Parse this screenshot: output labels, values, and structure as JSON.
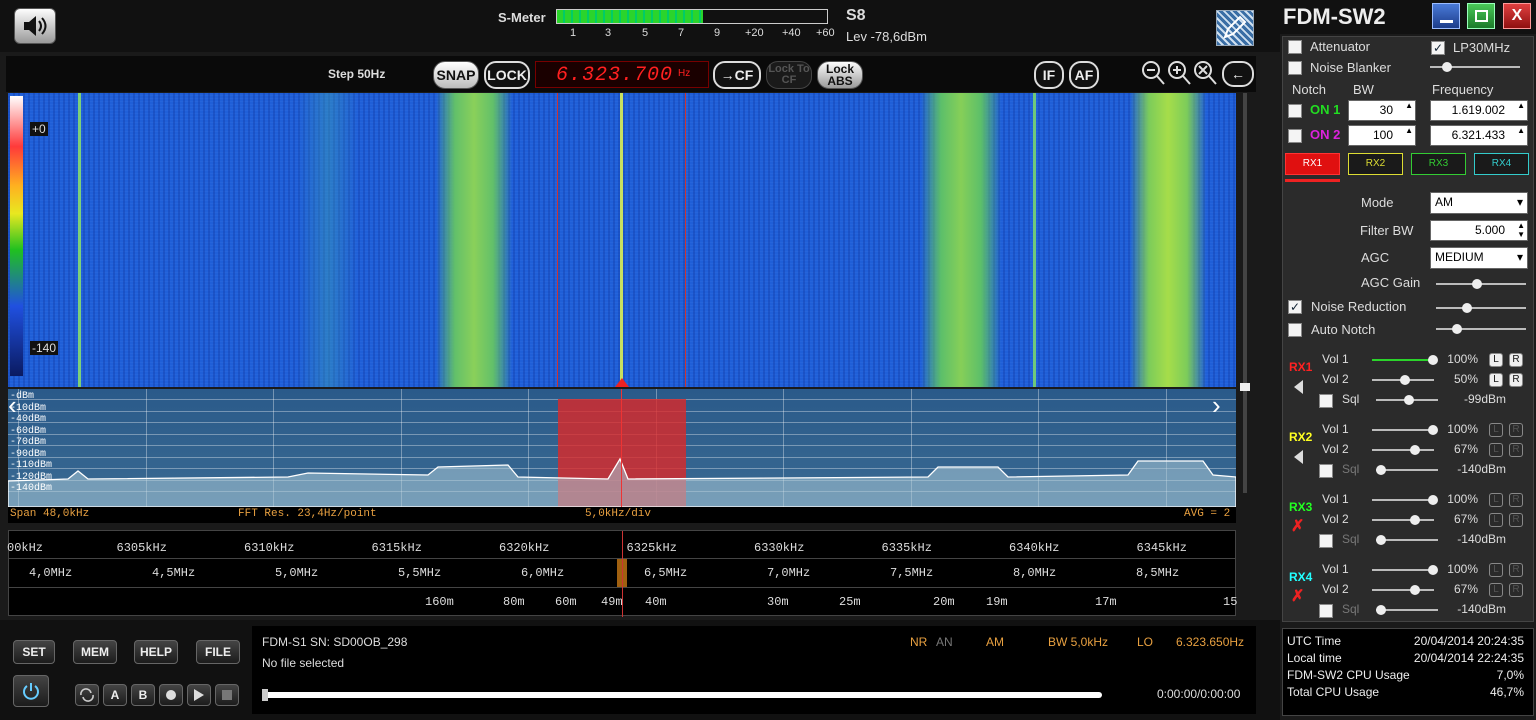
{
  "app": {
    "title": "FDM-SW2",
    "minimize_icon": "minimize-icon",
    "maximize_icon": "maximize-icon",
    "close_label": "X"
  },
  "top": {
    "smeter_label": "S-Meter",
    "smeter_scale": [
      "1",
      "3",
      "5",
      "7",
      "9",
      "+20",
      "+40",
      "+60"
    ],
    "smeter_reading": "S8",
    "level": "Lev -78,6dBm",
    "smeter_fill": 0.54
  },
  "toolbar": {
    "step": "Step 50Hz",
    "snap": "SNAP",
    "lock": "LOCK",
    "frequency": "6.323.700",
    "freq_unit": "Hz",
    "to_cf": "→CF",
    "lock_to_cf": "Lock To CF",
    "lock_abs": "Lock ABS",
    "if": "IF",
    "af": "AF",
    "back": "←"
  },
  "waterfall": {
    "scale_top": "+0",
    "scale_bottom": "-140"
  },
  "spectrum": {
    "db_labels": [
      "-dBm",
      "-10dBm",
      "-40dBm",
      "-60dBm",
      "-70dBm",
      "-90dBm",
      "-110dBm",
      "-120dBm",
      "-140dBm"
    ],
    "span": "Span 48,0kHz",
    "fft": "FFT Res. 23,4Hz/point",
    "div": "5,0kHz/div",
    "avg": "AVG = 2"
  },
  "scale": {
    "khz": [
      "00kHz",
      "6305kHz",
      "6310kHz",
      "6315kHz",
      "6320kHz",
      "6325kHz",
      "6330kHz",
      "6335kHz",
      "6340kHz",
      "6345kHz"
    ],
    "mhz": [
      "4,0MHz",
      "4,5MHz",
      "5,0MHz",
      "5,5MHz",
      "6,0MHz",
      "6,5MHz",
      "7,0MHz",
      "7,5MHz",
      "8,0MHz",
      "8,5MHz"
    ],
    "bands": [
      "160m",
      "80m",
      "60m",
      "49m",
      "40m",
      "30m",
      "25m",
      "20m",
      "19m",
      "17m",
      "15"
    ]
  },
  "bottom": {
    "set": "SET",
    "mem": "MEM",
    "help": "HELP",
    "file": "FILE",
    "device": "FDM-S1 SN: SD00OB_298",
    "file_status": "No file selected",
    "nr": "NR",
    "an": "AN",
    "mode": "AM",
    "bw": "BW 5,0kHz",
    "lo": "LO",
    "lo_freq": "6.323.650Hz",
    "time": "0:00:00/0:00:00",
    "transport": {
      "a": "A",
      "b": "B"
    }
  },
  "panel": {
    "attenuator": "Attenuator",
    "lp30": "LP30MHz",
    "noise_blanker": "Noise Blanker",
    "notch_header": "Notch",
    "bw_header": "BW",
    "freq_header": "Frequency",
    "notches": [
      {
        "label": "ON 1",
        "color": "#22dd22",
        "bw": "30",
        "freq": "1.619.002"
      },
      {
        "label": "ON 2",
        "color": "#dd22dd",
        "bw": "100",
        "freq": "6.321.433"
      }
    ],
    "rx_tabs": [
      {
        "label": "RX1",
        "color": "#ff3333"
      },
      {
        "label": "RX2",
        "color": "#dddd33"
      },
      {
        "label": "RX3",
        "color": "#33cc33"
      },
      {
        "label": "RX4",
        "color": "#33cccc"
      }
    ],
    "mode_label": "Mode",
    "mode_value": "AM",
    "filter_label": "Filter BW",
    "filter_value": "5.000",
    "agc_label": "AGC",
    "agc_value": "MEDIUM",
    "agc_gain": "AGC Gain",
    "noise_reduction": "Noise Reduction",
    "auto_notch": "Auto Notch",
    "receivers": [
      {
        "name": "RX1",
        "color": "#ff2222",
        "vol1": "Vol 1",
        "vol1_val": "100%",
        "vol1_level": 1.0,
        "vol2": "Vol 2",
        "vol2_val": "50%",
        "vol2_level": 0.5,
        "sql": "Sql",
        "sql_val": "-99dBm",
        "sql_level": 0.5,
        "active": true
      },
      {
        "name": "RX2",
        "color": "#ffff22",
        "vol1": "Vol 1",
        "vol1_val": "100%",
        "vol1_level": 1.0,
        "vol2": "Vol 2",
        "vol2_val": "67%",
        "vol2_level": 0.67,
        "sql": "Sql",
        "sql_val": "-140dBm",
        "sql_level": 0.0,
        "active": false
      },
      {
        "name": "RX3",
        "color": "#22ff22",
        "vol1": "Vol 1",
        "vol1_val": "100%",
        "vol1_level": 1.0,
        "vol2": "Vol 2",
        "vol2_val": "67%",
        "vol2_level": 0.67,
        "sql": "Sql",
        "sql_val": "-140dBm",
        "sql_level": 0.0,
        "active": false
      },
      {
        "name": "RX4",
        "color": "#22ffff",
        "vol1": "Vol 1",
        "vol1_val": "100%",
        "vol1_level": 1.0,
        "vol2": "Vol 2",
        "vol2_val": "67%",
        "vol2_level": 0.67,
        "sql": "Sql",
        "sql_val": "-140dBm",
        "sql_level": 0.0,
        "active": false
      }
    ],
    "status": [
      {
        "k": "UTC Time",
        "v": "20/04/2014 20:24:35"
      },
      {
        "k": "Local time",
        "v": "20/04/2014 22:24:35"
      },
      {
        "k": "FDM-SW2 CPU Usage",
        "v": "7,0%"
      },
      {
        "k": "Total CPU Usage",
        "v": "46,7%"
      }
    ]
  }
}
